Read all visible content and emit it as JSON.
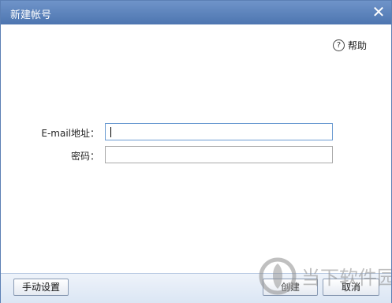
{
  "window": {
    "title": "新建帐号"
  },
  "help": {
    "label": "帮助",
    "icon": "question-circle-icon"
  },
  "form": {
    "email": {
      "label": "E-mail地址：",
      "value": "",
      "placeholder": ""
    },
    "password": {
      "label": "密码：",
      "value": "",
      "placeholder": ""
    }
  },
  "footer": {
    "manual_label": "手动设置",
    "create_label": "创建",
    "cancel_label": "取消"
  },
  "watermark": {
    "text": "当下软件园"
  },
  "colors": {
    "titlebar": "#4d75b0",
    "footer": "#dbe6f4",
    "focus_border": "#6b9bd1"
  }
}
